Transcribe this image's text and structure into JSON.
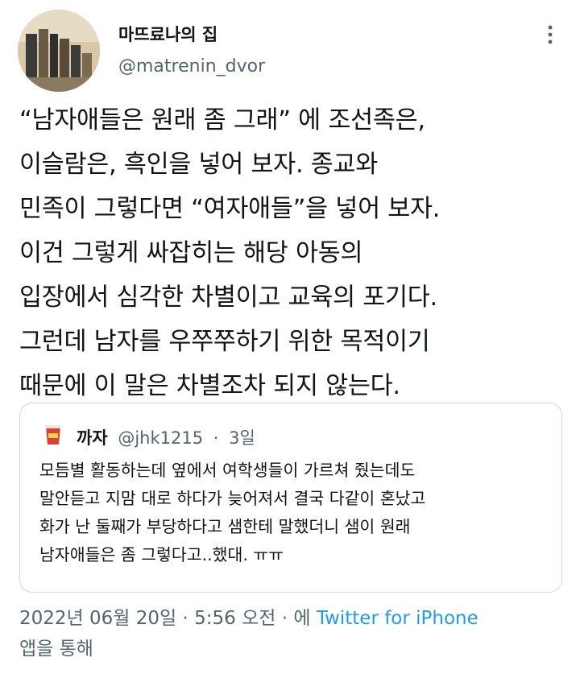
{
  "author": {
    "display_name": "마뜨료나의 집",
    "handle": "@matrenin_dvor"
  },
  "tweet": {
    "lines": [
      "“남자애들은 원래 좀 그래” 에 조선족은,",
      "이슬람은, 흑인을 넣어 보자. 종교와",
      "민족이 그렇다면 “여자애들”을 넣어 보자.",
      "이건 그렇게 싸잡히는 해당 아동의",
      "입장에서 심각한 차별이고 교육의 포기다.",
      "그런데 남자를 우쭈쭈하기 위한 목적이기",
      "때문에 이 말은 차별조차 되지 않는다."
    ]
  },
  "quoted": {
    "name": "까자",
    "handle": "@jhk1215",
    "separator": "·",
    "time": "3일",
    "lines": [
      "모듬별 활동하는데 옆에서 여학생들이 가르쳐 줬는데도",
      "말안듣고 지맘 대로 하다가 늦어져서 결국 다같이 혼났고",
      "화가 난 둘째가 부당하다고 샘한테 말했더니 샘이 원래",
      "남자애들은 좀 그렇다고..했대. ㅠㅠ"
    ]
  },
  "meta": {
    "date": "2022년 06월 20일",
    "separator": "·",
    "time": "5:56 오전",
    "via_prefix": "· 에",
    "source": "Twitter for iPhone",
    "via_suffix": "앱을 통해"
  },
  "colors": {
    "text": "#0f1419",
    "secondary": "#536471",
    "link": "#1d9bf0",
    "border": "#cfd9de"
  },
  "icons": {
    "more": "more-vertical-icon"
  }
}
